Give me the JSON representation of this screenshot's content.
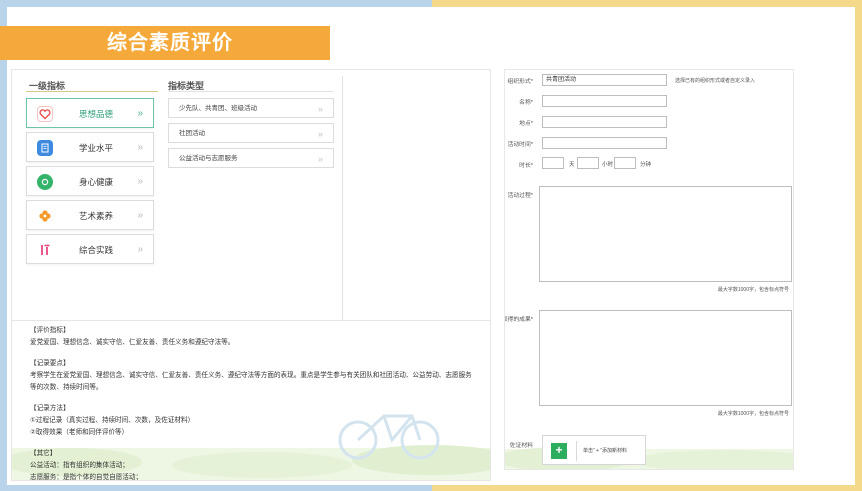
{
  "slide": {
    "title": "综合素质评价"
  },
  "left": {
    "col1_header": "一级指标",
    "col2_header": "指标类型",
    "indicators": [
      {
        "label": "思想品德",
        "icon": "heart-icon",
        "color": "#e9504f"
      },
      {
        "label": "学业水平",
        "icon": "book-icon",
        "color": "#3d8be0"
      },
      {
        "label": "身心健康",
        "icon": "health-icon",
        "color": "#34b46b"
      },
      {
        "label": "艺术素养",
        "icon": "flower-icon",
        "color": "#f39a2b"
      },
      {
        "label": "综合实践",
        "icon": "tools-icon",
        "color": "#e8467f"
      }
    ],
    "types": [
      {
        "label": "少先队、共青团、班级活动"
      },
      {
        "label": "社团活动"
      },
      {
        "label": "公益活动与志愿服务"
      }
    ],
    "chevron": "»",
    "notes": [
      "【评价指标】",
      "爱党爱国、理想信念、诚实守信、仁爱友善、责任义务和遵纪守法等。",
      "【记录要点】",
      "考察学生在爱党爱国、理想信念、诚实守信、仁爱友善、责任义务、遵纪守法等方面的表现。重点是学生参与有关团队和社团活动、公益劳动、志愿服务",
      "等的次数、持续时间等。",
      "【记录方法】",
      "①过程记录（真实过程、持续时间、次数，及佐证材料）",
      "②取得效果（老师和同伴评价等）",
      "【其它】",
      "公益活动：指有组织的集体活动；",
      "志愿服务：是指个体的自觉自愿活动；"
    ]
  },
  "form": {
    "org_label": "组织形式*",
    "org_value": "共青团活动",
    "org_hint": "选择已有的组织形式或者自定义录入",
    "name_label": "名称*",
    "place_label": "地点*",
    "time_label": "活动时间*",
    "duration_label": "时长*",
    "unit_day": "天",
    "unit_hour": "小时",
    "unit_minute": "分钟",
    "process_label": "活动过程*",
    "process_count": "最大字数1000字，包含标点符号",
    "result_label": "取得的成果*",
    "result_count": "最大字数1000字，包含标点符号",
    "evidence_label": "佐证材料",
    "upload_plus": "+",
    "upload_text": "单击“ + ”添加新材料"
  }
}
